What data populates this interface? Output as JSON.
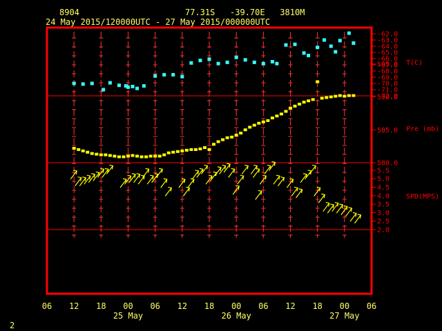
{
  "header": {
    "station": "8904",
    "location": "77.31S   -39.70E   3810M",
    "period": "24 May 2015/120000UTC - 27 May 2015/000000UTC"
  },
  "footer": {
    "page": "2"
  },
  "colors": {
    "background": "#000000",
    "frame": "#ff0000",
    "header_text": "#ffff66",
    "temperature": "#33ffff",
    "pressure": "#ffff00",
    "wind": "#ffff00",
    "ticks": "#ff3333"
  },
  "chart_data": [
    {
      "type": "scatter",
      "panel": "temperature",
      "ylabel": "T(C)",
      "ylim": [
        -72,
        -62
      ],
      "yticks": [
        "-62.0",
        "-63.0",
        "-64.0",
        "-65.0",
        "-66.0",
        "-67.0",
        "-68.0",
        "-69.0",
        "-70.0",
        "-71.0",
        "-72.0"
      ],
      "x_hours": [
        12,
        14,
        16,
        18.5,
        20,
        22,
        23.5,
        24,
        25,
        26,
        27.5,
        30,
        32,
        34,
        36,
        38,
        40,
        42,
        44,
        46,
        48,
        50,
        52,
        54,
        56,
        57,
        59,
        61,
        63,
        64,
        66,
        67.5,
        69,
        70,
        71,
        73,
        74
      ],
      "values": [
        -70.0,
        -70.1,
        -70.0,
        -71.0,
        -69.9,
        -70.3,
        -70.4,
        -70.6,
        -70.5,
        -70.8,
        -70.4,
        -68.8,
        -68.6,
        -68.6,
        -68.9,
        -66.7,
        -66.3,
        -66.1,
        -66.8,
        -66.6,
        -65.8,
        -66.2,
        -66.6,
        -66.8,
        -66.5,
        -66.8,
        -63.8,
        -63.7,
        -65.1,
        -65.5,
        -64.2,
        -63.0,
        -64.0,
        -64.9,
        -63.1,
        -61.9,
        -63.5
      ]
    },
    {
      "type": "scatter",
      "panel": "pressure",
      "ylabel": "Pre (mb)",
      "ylim": [
        580,
        598
      ],
      "yticks": [
        "595.0",
        "590.0",
        "585.0",
        "580.0"
      ],
      "x_hours": [
        12,
        13,
        14,
        15,
        16,
        17,
        18,
        19,
        20,
        21,
        22,
        23,
        24,
        25,
        26,
        27,
        28,
        29,
        30,
        31,
        32,
        33,
        34,
        35,
        36,
        37,
        38,
        39,
        40,
        41,
        42,
        43,
        44,
        45,
        46,
        47,
        48,
        49,
        50,
        51,
        52,
        53,
        54,
        55,
        56,
        57,
        58,
        59,
        60,
        61,
        62,
        63,
        64,
        65,
        66,
        67,
        68,
        69,
        70,
        71,
        72,
        73,
        74
      ],
      "values": [
        582.2,
        582.0,
        581.8,
        581.6,
        581.4,
        581.3,
        581.2,
        581.2,
        581.1,
        581.0,
        580.9,
        580.9,
        581.0,
        581.1,
        581.0,
        580.9,
        580.9,
        581.0,
        581.0,
        581.0,
        581.2,
        581.5,
        581.6,
        581.7,
        581.8,
        581.9,
        582.0,
        582.0,
        582.1,
        582.3,
        582.0,
        582.8,
        583.2,
        583.5,
        583.8,
        583.9,
        584.2,
        584.5,
        585.0,
        585.4,
        585.7,
        586.0,
        586.2,
        586.4,
        586.8,
        587.1,
        587.4,
        587.8,
        588.3,
        588.6,
        588.9,
        589.2,
        589.4,
        589.6,
        592.3,
        589.8,
        589.9,
        590.0,
        590.1,
        590.2,
        590.1,
        590.2,
        590.2,
        590.2
      ]
    },
    {
      "type": "scatter",
      "panel": "wind",
      "ylabel": "SPD(MPS)",
      "ylim": [
        2.0,
        5.5
      ],
      "yticks": [
        "5.5",
        "5.0",
        "4.5",
        "4.0",
        "3.5",
        "3.0",
        "2.5",
        "2.0"
      ],
      "x_hours": [
        12,
        13,
        14,
        15,
        16,
        17,
        18,
        19,
        20,
        23,
        24,
        25,
        26,
        27,
        28,
        29,
        30,
        31,
        32,
        33,
        36,
        37,
        38,
        39,
        40,
        41,
        42,
        43,
        44,
        45,
        46,
        47,
        48,
        49,
        50,
        52,
        52.5,
        53,
        54,
        55,
        56,
        57,
        58,
        60,
        61,
        62,
        63,
        64,
        65,
        66,
        67,
        68,
        69,
        70,
        71,
        72,
        73,
        74,
        75
      ],
      "values": [
        5.3,
        4.9,
        4.9,
        5.0,
        5.1,
        5.2,
        5.4,
        5.4,
        5.6,
        4.8,
        5.0,
        5.1,
        5.1,
        5.0,
        5.4,
        5.0,
        5.1,
        5.4,
        4.8,
        4.3,
        4.8,
        4.3,
        4.8,
        5.3,
        5.4,
        5.6,
        5.0,
        5.2,
        5.5,
        5.6,
        5.7,
        5.4,
        4.4,
        5.0,
        5.6,
        5.6,
        5.4,
        4.1,
        5.0,
        5.6,
        5.8,
        5.0,
        4.9,
        4.8,
        4.3,
        4.2,
        5.1,
        5.3,
        5.6,
        4.3,
        3.9,
        3.4,
        3.3,
        3.4,
        3.3,
        3.2,
        3.1,
        2.8,
        2.7
      ]
    }
  ],
  "x_axis": {
    "ticks": [
      {
        "h": 6,
        "label": "06"
      },
      {
        "h": 12,
        "label": "12"
      },
      {
        "h": 18,
        "label": "18"
      },
      {
        "h": 24,
        "label": "00"
      },
      {
        "h": 30,
        "label": "06"
      },
      {
        "h": 36,
        "label": "12"
      },
      {
        "h": 42,
        "label": "18"
      },
      {
        "h": 48,
        "label": "00"
      },
      {
        "h": 54,
        "label": "06"
      },
      {
        "h": 60,
        "label": "12"
      },
      {
        "h": 66,
        "label": "18"
      },
      {
        "h": 72,
        "label": "00"
      },
      {
        "h": 78,
        "label": "06"
      }
    ],
    "dates": [
      {
        "h": 24,
        "label": "25 May"
      },
      {
        "h": 48,
        "label": "26 May"
      },
      {
        "h": 72,
        "label": "27 May"
      }
    ]
  }
}
